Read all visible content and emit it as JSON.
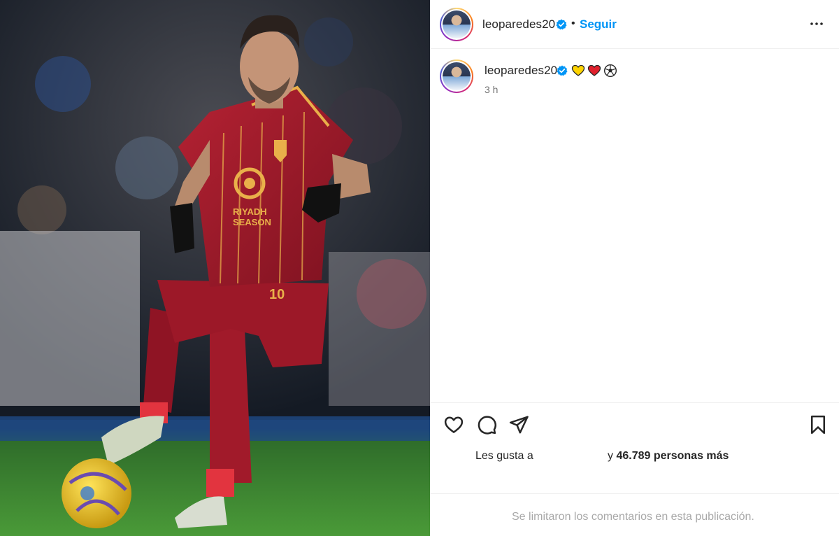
{
  "post": {
    "image_alt": "Jugador con camiseta roja de la AS Roma conduciendo el balón",
    "shirt_sponsor_line1": "RIYADH",
    "shirt_sponsor_line2": "SEASON",
    "shirt_number": "10"
  },
  "header": {
    "username": "leoparedes20",
    "separator": "•",
    "follow_label": "Seguir",
    "more_icon": "more-horizontal-icon",
    "verified_color": "#0095f6"
  },
  "caption": {
    "username": "leoparedes20",
    "emojis": [
      "yellow-heart",
      "red-heart",
      "soccer-ball"
    ],
    "time": "3 h"
  },
  "actions": {
    "like_icon": "heart-icon",
    "comment_icon": "comment-icon",
    "share_icon": "share-icon",
    "save_icon": "bookmark-icon",
    "likes_prefix": "Les gusta a",
    "likes_connector": "y",
    "likes_count_text": "46.789 personas más"
  },
  "footer": {
    "comments_limited": "Se limitaron los comentarios en esta publicación."
  },
  "colors": {
    "accent": "#0095f6",
    "text": "#262626",
    "muted": "#737373",
    "border": "#efefef",
    "jersey": "#a3192a",
    "jersey_trim": "#e9b04a"
  }
}
